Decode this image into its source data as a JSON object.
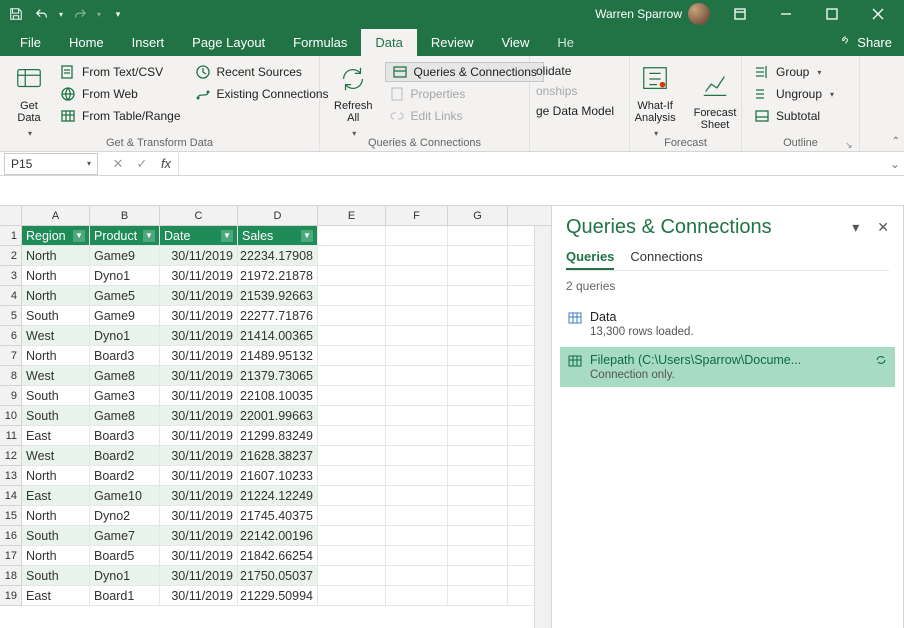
{
  "titlebar": {
    "user_name": "Warren Sparrow"
  },
  "tabs": {
    "file": "File",
    "home": "Home",
    "insert": "Insert",
    "page_layout": "Page Layout",
    "formulas": "Formulas",
    "data": "Data",
    "review": "Review",
    "view": "View",
    "help_cut": "He",
    "share": "Share"
  },
  "ribbon": {
    "get_transform": {
      "label": "Get & Transform Data",
      "get_data": "Get\nData",
      "from_textcsv": "From Text/CSV",
      "from_web": "From Web",
      "from_table": "From Table/Range",
      "recent_sources": "Recent Sources",
      "existing_connections": "Existing Connections"
    },
    "refresh": {
      "refresh_all": "Refresh\nAll"
    },
    "qc": {
      "label": "Queries & Connections",
      "queries_connections": "Queries & Connections",
      "properties": "Properties",
      "edit_links": "Edit Links"
    },
    "cutoff": {
      "olidate": "olidate",
      "onships": "onships",
      "ge_data_model": "ge Data Model"
    },
    "forecast": {
      "label": "Forecast",
      "what_if": "What-If\nAnalysis",
      "forecast_sheet": "Forecast\nSheet"
    },
    "outline": {
      "label": "Outline",
      "group": "Group",
      "ungroup": "Ungroup",
      "subtotal": "Subtotal"
    }
  },
  "formula_bar": {
    "name_box": "P15",
    "formula": ""
  },
  "grid": {
    "columns": [
      "A",
      "B",
      "C",
      "D",
      "E",
      "F",
      "G"
    ],
    "headers": [
      "Region",
      "Product",
      "Date",
      "Sales"
    ],
    "rows": [
      {
        "n": 1
      },
      {
        "n": 2,
        "region": "North",
        "product": "Game9",
        "date": "30/11/2019",
        "sales": "22234.17908"
      },
      {
        "n": 3,
        "region": "North",
        "product": "Dyno1",
        "date": "30/11/2019",
        "sales": "21972.21878"
      },
      {
        "n": 4,
        "region": "North",
        "product": "Game5",
        "date": "30/11/2019",
        "sales": "21539.92663"
      },
      {
        "n": 5,
        "region": "South",
        "product": "Game9",
        "date": "30/11/2019",
        "sales": "22277.71876"
      },
      {
        "n": 6,
        "region": "West",
        "product": "Dyno1",
        "date": "30/11/2019",
        "sales": "21414.00365"
      },
      {
        "n": 7,
        "region": "North",
        "product": "Board3",
        "date": "30/11/2019",
        "sales": "21489.95132"
      },
      {
        "n": 8,
        "region": "West",
        "product": "Game8",
        "date": "30/11/2019",
        "sales": "21379.73065"
      },
      {
        "n": 9,
        "region": "South",
        "product": "Game3",
        "date": "30/11/2019",
        "sales": "22108.10035"
      },
      {
        "n": 10,
        "region": "South",
        "product": "Game8",
        "date": "30/11/2019",
        "sales": "22001.99663"
      },
      {
        "n": 11,
        "region": "East",
        "product": "Board3",
        "date": "30/11/2019",
        "sales": "21299.83249"
      },
      {
        "n": 12,
        "region": "West",
        "product": "Board2",
        "date": "30/11/2019",
        "sales": "21628.38237"
      },
      {
        "n": 13,
        "region": "North",
        "product": "Board2",
        "date": "30/11/2019",
        "sales": "21607.10233"
      },
      {
        "n": 14,
        "region": "East",
        "product": "Game10",
        "date": "30/11/2019",
        "sales": "21224.12249"
      },
      {
        "n": 15,
        "region": "North",
        "product": "Dyno2",
        "date": "30/11/2019",
        "sales": "21745.40375"
      },
      {
        "n": 16,
        "region": "South",
        "product": "Game7",
        "date": "30/11/2019",
        "sales": "22142.00196"
      },
      {
        "n": 17,
        "region": "North",
        "product": "Board5",
        "date": "30/11/2019",
        "sales": "21842.66254"
      },
      {
        "n": 18,
        "region": "South",
        "product": "Dyno1",
        "date": "30/11/2019",
        "sales": "21750.05037"
      },
      {
        "n": 19,
        "region": "East",
        "product": "Board1",
        "date": "30/11/2019",
        "sales": "21229.50994"
      }
    ]
  },
  "pane": {
    "title": "Queries & Connections",
    "tab_queries": "Queries",
    "tab_connections": "Connections",
    "count_label": "2 queries",
    "items": [
      {
        "name": "Data",
        "status": "13,300 rows loaded.",
        "selected": false
      },
      {
        "name": "Filepath (C:\\Users\\Sparrow\\Docume...",
        "status": "Connection only.",
        "selected": true
      }
    ]
  }
}
